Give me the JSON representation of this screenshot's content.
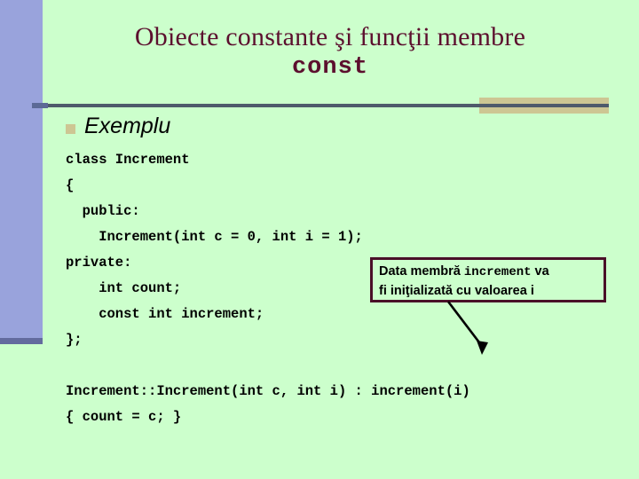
{
  "slide": {
    "title_line1": "Obiecte constante şi funcţii membre",
    "title_line2": "const",
    "bullet_heading": "Exemplu",
    "code_lines": [
      "class Increment",
      "{",
      "  public:",
      "    Increment(int c = 0, int i = 1);",
      "private:",
      "    int count;",
      "    const int increment;",
      "};",
      "",
      "Increment::Increment(int c, int i) : increment(i)",
      "{ count = c; }"
    ],
    "callout": {
      "line1_prefix": "Data membră ",
      "line1_mono": "increment",
      "line1_suffix": " va",
      "line2": "fi iniţializată cu valoarea i"
    },
    "colors": {
      "background": "#ccffcc",
      "sidebar": "#99a3dc",
      "sidebar_foot": "#636b9e",
      "title": "#5c0f2e",
      "rule": "#4e5a6b",
      "tan": "#cdc693",
      "callout_border": "#4a1028",
      "code_text": "#000000",
      "arrow": "#000000"
    },
    "icons": {
      "bullet": "square-bullet-icon",
      "arrow": "arrow-down-right-icon"
    }
  }
}
